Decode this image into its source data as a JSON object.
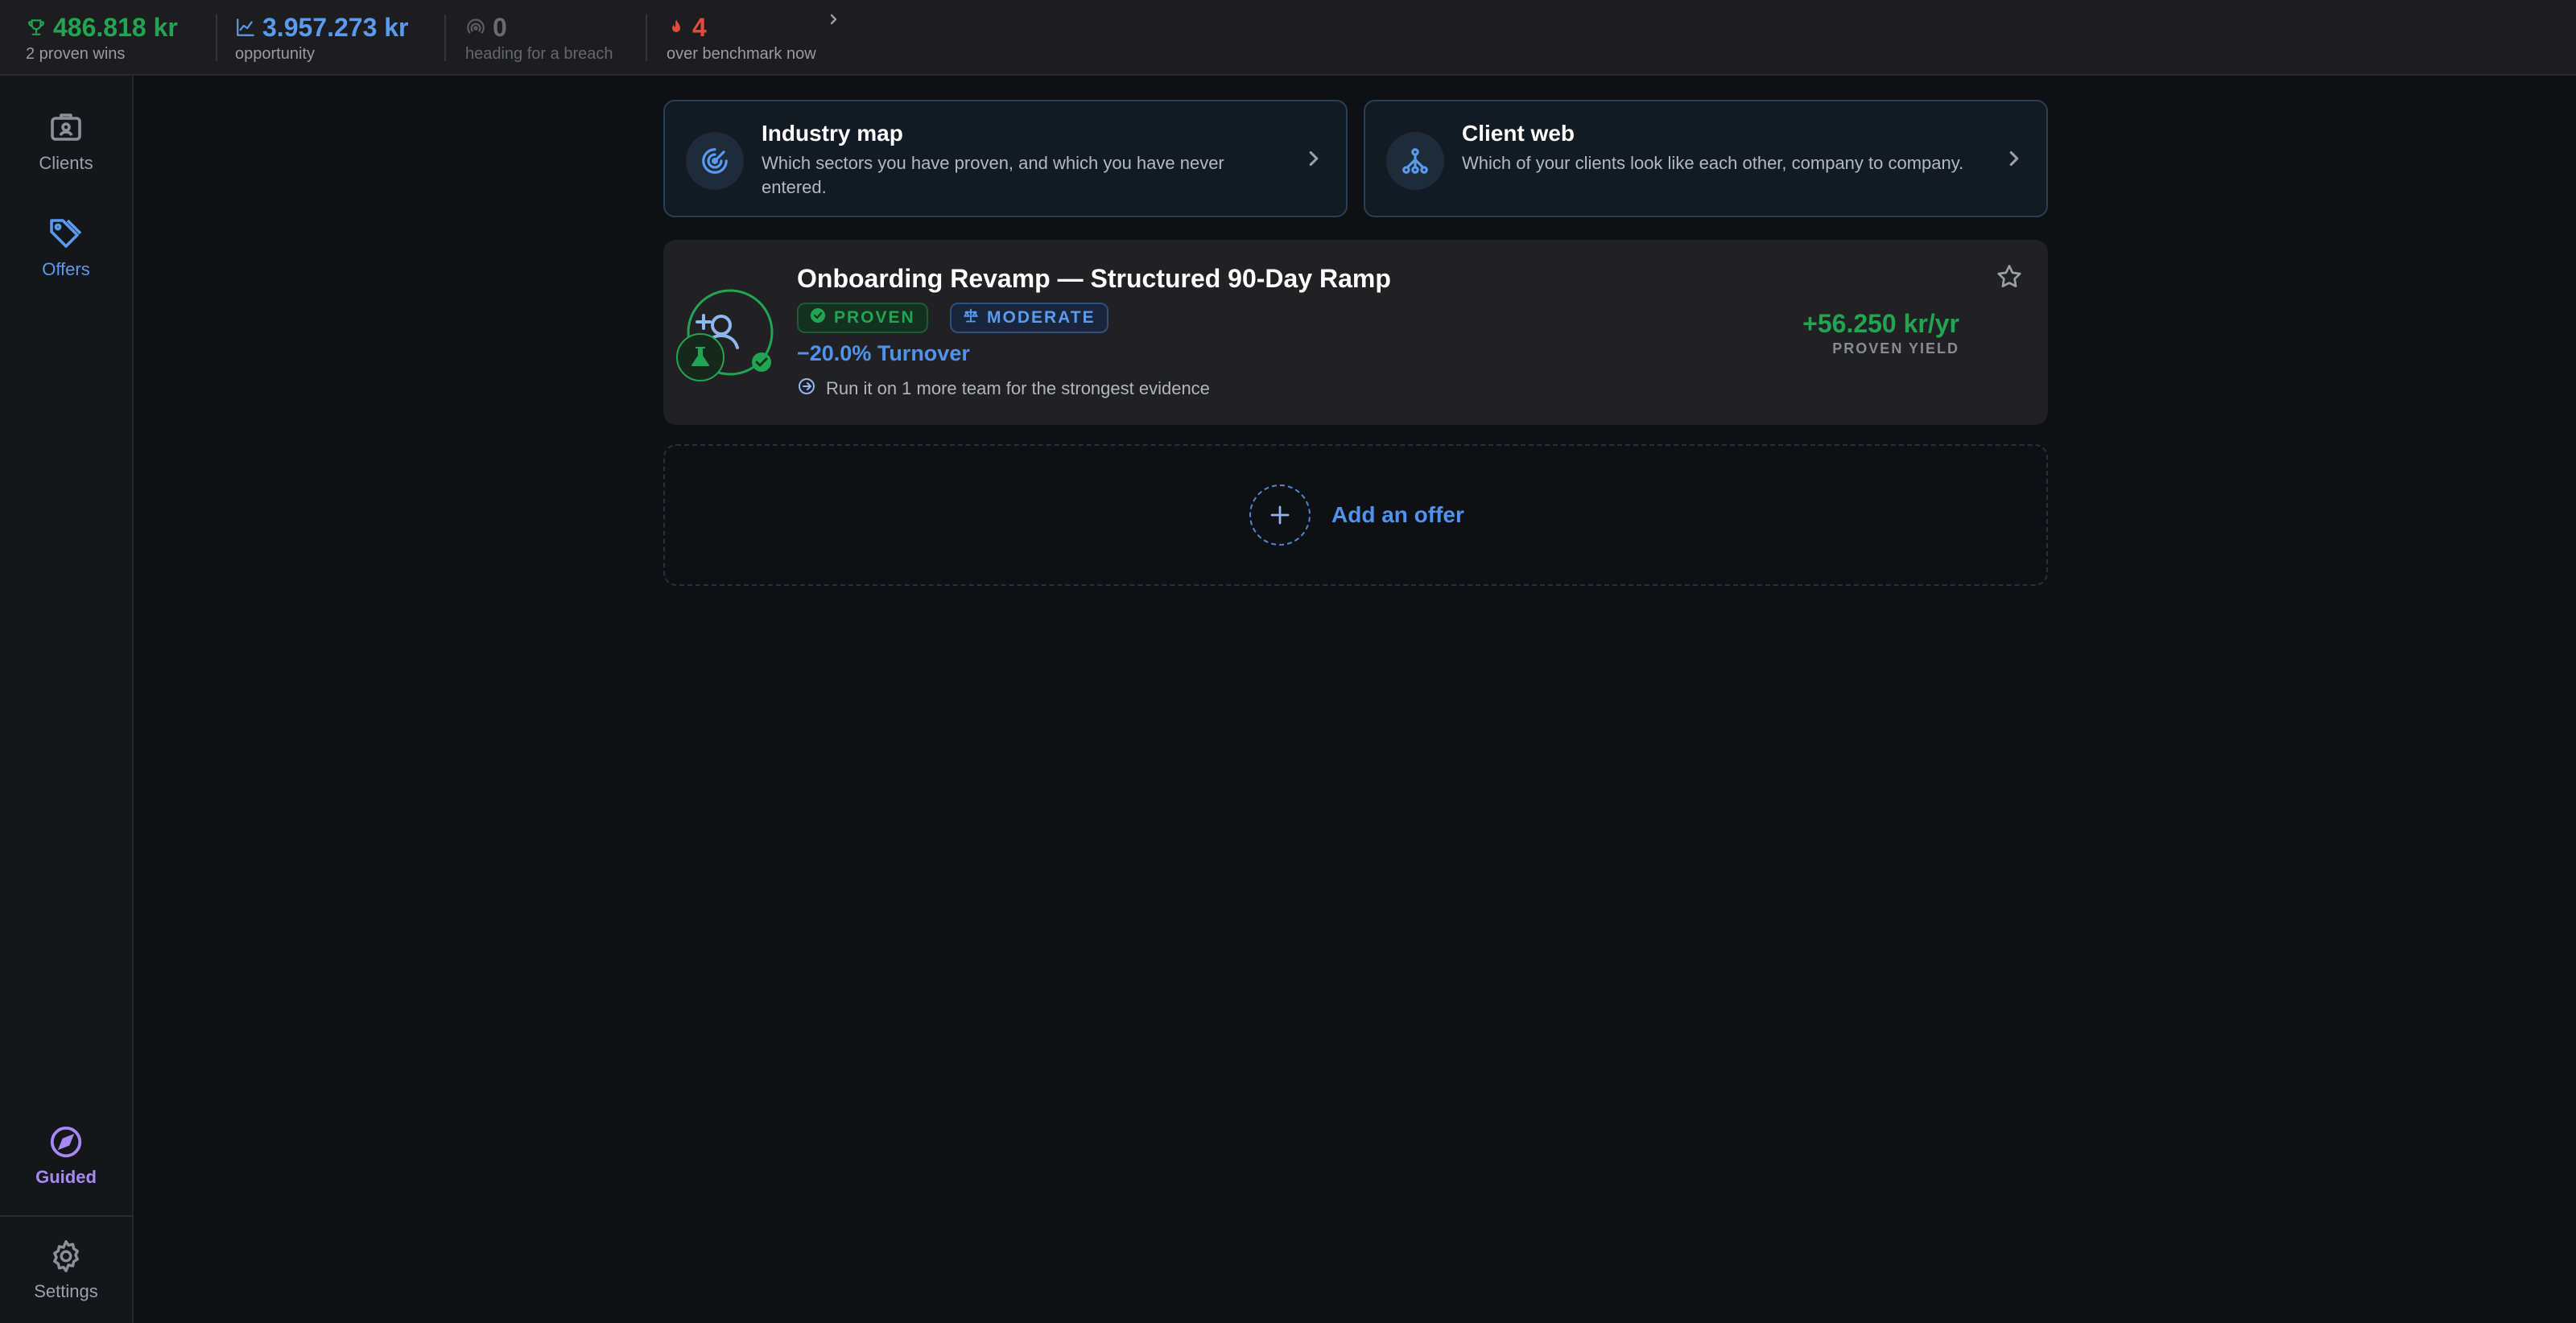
{
  "stats": [
    {
      "value": "486.818 kr",
      "label": "2 proven wins",
      "icon": "trophy-icon",
      "color": "#22a552"
    },
    {
      "value": "3.957.273 kr",
      "label": "opportunity",
      "icon": "trend-chart-icon",
      "color": "#5a9bf0"
    },
    {
      "value": "0",
      "label": "heading for a breach",
      "icon": "radar-icon",
      "color": "#5c5d62"
    },
    {
      "value": "4",
      "label": "over benchmark now",
      "icon": "flame-icon",
      "color": "#e5483d"
    }
  ],
  "sidebar": {
    "items": [
      {
        "label": "Clients",
        "icon": "briefcase-icon",
        "active": false
      },
      {
        "label": "Offers",
        "icon": "tag-icon",
        "active": true
      }
    ],
    "bottom": [
      {
        "label": "Guided",
        "icon": "compass-icon",
        "color": "#a58af5"
      },
      {
        "label": "Settings",
        "icon": "gear-icon"
      }
    ]
  },
  "nav_cards": [
    {
      "title": "Industry map",
      "desc": "Which sectors you have proven, and which you have never entered.",
      "icon": "target-icon"
    },
    {
      "title": "Client web",
      "desc": "Which of your clients look like each other, company to company.",
      "icon": "network-icon"
    }
  ],
  "offer": {
    "title": "Onboarding Revamp — Structured 90-Day Ramp",
    "badges": [
      "PROVEN",
      "MODERATE"
    ],
    "metric": "−20.0% Turnover",
    "hint": "Run it on 1 more team for the strongest evidence",
    "yield_value": "+56.250 kr/yr",
    "yield_label": "PROVEN YIELD"
  },
  "add_offer": {
    "label": "Add an offer",
    "icon": "plus-icon"
  },
  "colors": {
    "accent": "#4f93ef",
    "success": "#22a552",
    "danger": "#e5483d"
  }
}
